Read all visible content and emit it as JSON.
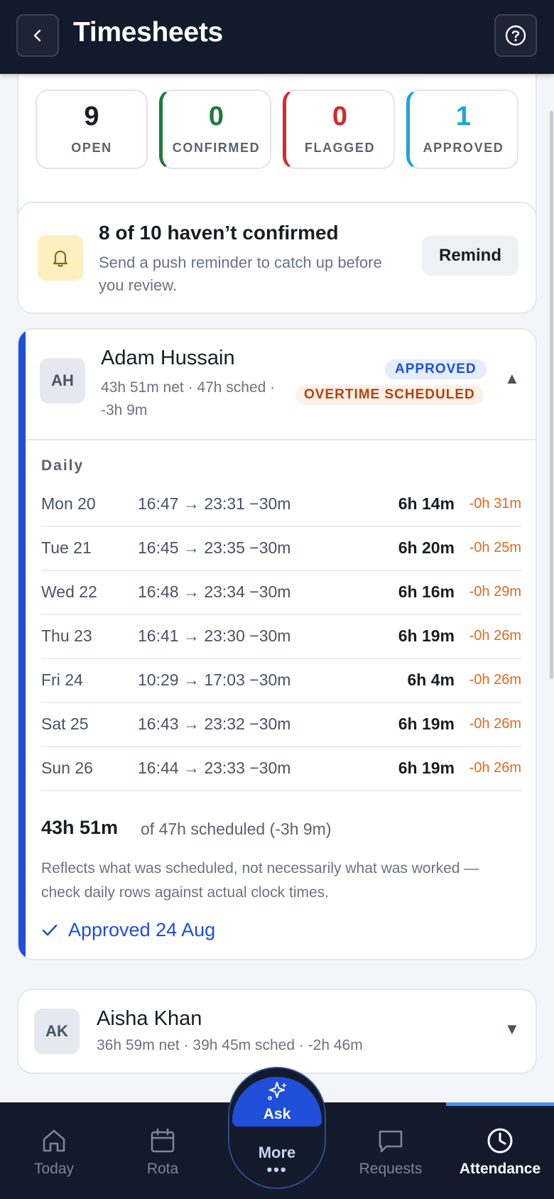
{
  "header": {
    "title": "Timesheets"
  },
  "stats": [
    {
      "value": "9",
      "label": "OPEN",
      "color": "#1a1d24"
    },
    {
      "value": "0",
      "label": "CONFIRMED",
      "color": "#1e7a3c"
    },
    {
      "value": "0",
      "label": "FLAGGED",
      "color": "#d42a2a"
    },
    {
      "value": "1",
      "label": "APPROVED",
      "color": "#1ea6dc"
    }
  ],
  "reminder": {
    "title": "8 of 10 haven’t confirmed",
    "subtitle": "Send a push reminder to catch up before you review.",
    "button": "Remind"
  },
  "employees": [
    {
      "initials": "AH",
      "name": "Adam Hussain",
      "meta_line1": "43h 51m net · 47h sched ·",
      "meta_line2": "-3h 9m",
      "badge_status": "APPROVED",
      "badge_flag": "OVERTIME SCHEDULED",
      "daily_label": "Daily",
      "days": [
        {
          "day": "Mon 20",
          "time": "16:47 → 23:31 −30m",
          "hours": "6h 14m",
          "diff": "-0h 31m"
        },
        {
          "day": "Tue 21",
          "time": "16:45 → 23:35 −30m",
          "hours": "6h 20m",
          "diff": "-0h 25m"
        },
        {
          "day": "Wed 22",
          "time": "16:48 → 23:34 −30m",
          "hours": "6h 16m",
          "diff": "-0h 29m"
        },
        {
          "day": "Thu 23",
          "time": "16:41 → 23:30 −30m",
          "hours": "6h 19m",
          "diff": "-0h 26m"
        },
        {
          "day": "Fri 24",
          "time": "10:29 → 17:03 −30m",
          "hours": "6h 4m",
          "diff": "-0h 26m"
        },
        {
          "day": "Sat 25",
          "time": "16:43 → 23:32 −30m",
          "hours": "6h 19m",
          "diff": "-0h 26m"
        },
        {
          "day": "Sun 26",
          "time": "16:44 → 23:33 −30m",
          "hours": "6h 19m",
          "diff": "-0h 26m"
        }
      ],
      "total": "43h 51m",
      "total_of": "of 47h scheduled (-3h 9m)",
      "note": "Reflects what was scheduled, not necessarily what was worked — check daily rows against actual clock times.",
      "approved_text": "Approved 24 Aug"
    },
    {
      "initials": "AK",
      "name": "Aisha Khan",
      "meta_line1": "36h 59m net · 39h 45m sched · -2h 46m"
    }
  ],
  "nav": {
    "today": "Today",
    "rota": "Rota",
    "ask": "Ask",
    "more": "More",
    "more_dots": "•••",
    "requests": "Requests",
    "attendance": "Attendance"
  }
}
